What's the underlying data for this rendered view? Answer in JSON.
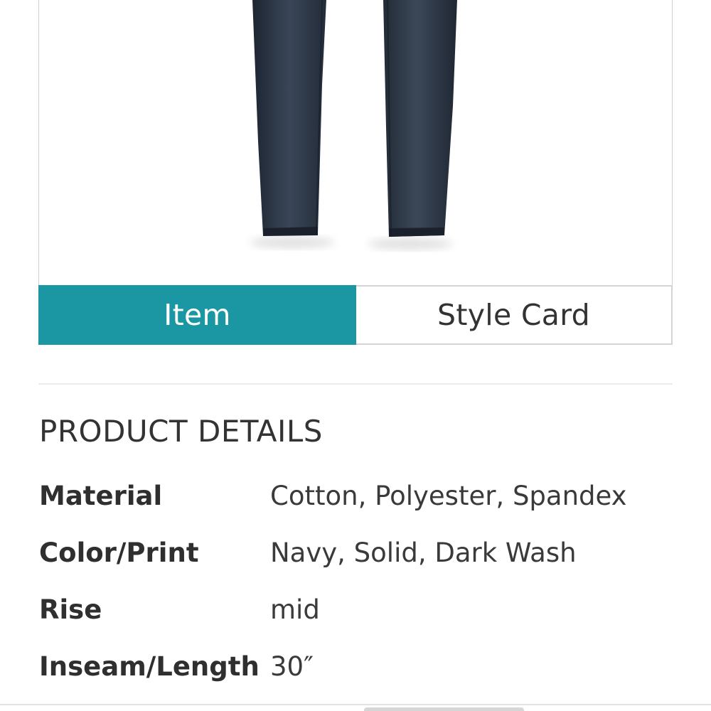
{
  "product_image": {
    "icon": "jeans-product-photo",
    "color": "#2b3442"
  },
  "tabs": [
    {
      "label": "Item",
      "active": true
    },
    {
      "label": "Style Card",
      "active": false
    }
  ],
  "colors": {
    "accent": "#1b97a3",
    "text": "#2f2f2f"
  },
  "section": {
    "title": "PRODUCT DETAILS"
  },
  "details": [
    {
      "label": "Material",
      "value": "Cotton, Polyester, Spandex"
    },
    {
      "label": "Color/Print",
      "value": "Navy, Solid, Dark Wash"
    },
    {
      "label": "Rise",
      "value": "mid"
    },
    {
      "label": "Inseam/Length",
      "value": "30″"
    }
  ]
}
